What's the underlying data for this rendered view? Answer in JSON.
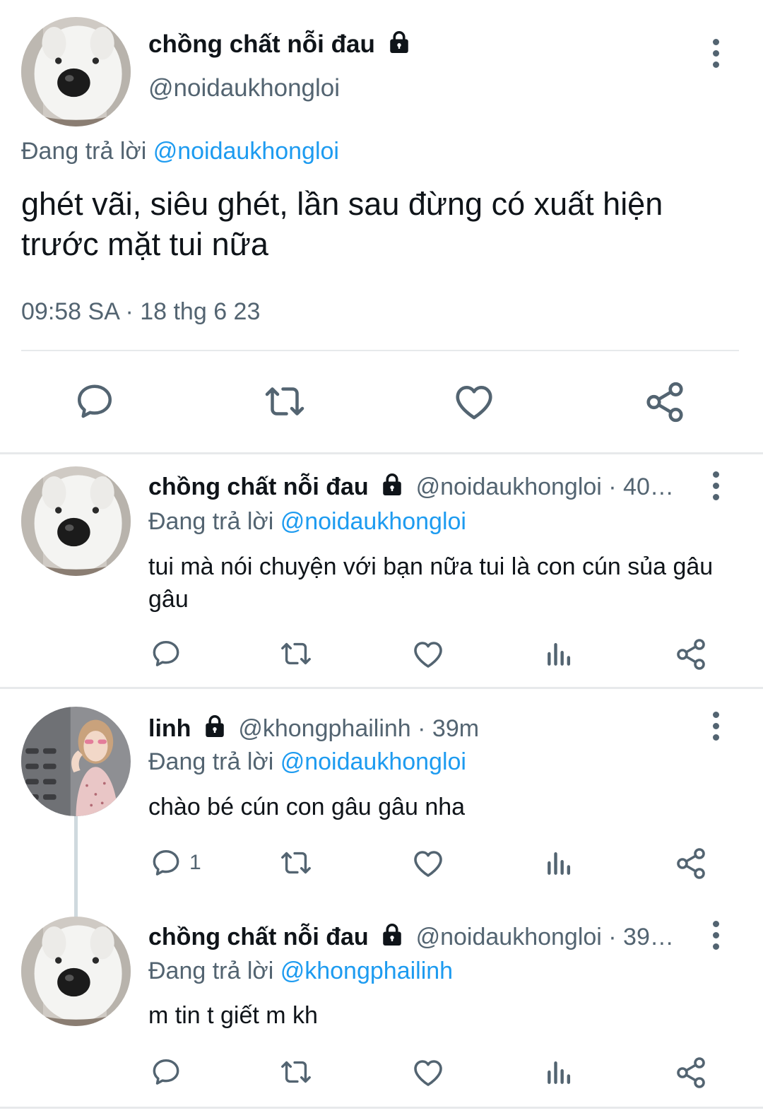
{
  "main_tweet": {
    "display_name": "chồng chất nỗi đau",
    "handle": "@noidaukhongloi",
    "replying_prefix": "Đang trả lời",
    "replying_to": "@noidaukhongloi",
    "text": "ghét vãi, siêu ghét, lần sau đừng có xuất hiện trước mặt tui nữa",
    "timestamp": "09:58 SA · 18 thg 6 23",
    "icons": [
      "reply-icon",
      "retweet-icon",
      "like-icon",
      "share-icon"
    ]
  },
  "replies": [
    {
      "display_name": "chồng chất nỗi đau",
      "meta": "@noidaukhongloi · 40…",
      "replying_prefix": "Đang trả lời",
      "replying_to": "@noidaukhongloi",
      "text": "tui mà nói chuyện với bạn nữa tui là con cún sủa gâu gâu",
      "reply_count": ""
    },
    {
      "display_name": "linh",
      "meta": "@khongphailinh · 39m",
      "replying_prefix": "Đang trả lời",
      "replying_to": "@noidaukhongloi",
      "text": "chào bé cún con gâu gâu nha",
      "reply_count": "1"
    },
    {
      "display_name": "chồng chất nỗi đau",
      "meta": "@noidaukhongloi · 39…",
      "replying_prefix": "Đang trả lời",
      "replying_to": "@khongphailinh",
      "text": "m tin t giết m kh",
      "reply_count": ""
    }
  ],
  "colors": {
    "text": "#0f1419",
    "secondary": "#536471",
    "link": "#1d9bf0",
    "divider": "#e7e9eb"
  }
}
